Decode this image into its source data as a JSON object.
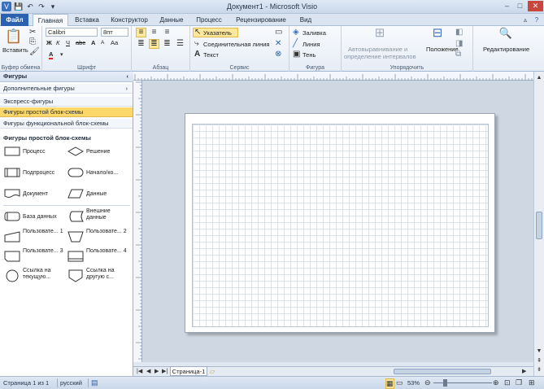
{
  "window": {
    "title": "Документ1 - Microsoft Visio",
    "min": "–",
    "max": "□",
    "close": "✕"
  },
  "quick_access": {
    "save": "💾",
    "undo": "↶",
    "redo": "↷",
    "customize": "▾"
  },
  "tabs": [
    {
      "label": "Файл"
    },
    {
      "label": "Главная"
    },
    {
      "label": "Вставка"
    },
    {
      "label": "Конструктор"
    },
    {
      "label": "Данные"
    },
    {
      "label": "Процесс"
    },
    {
      "label": "Рецензирование"
    },
    {
      "label": "Вид"
    }
  ],
  "ribbon": {
    "clipboard": {
      "paste": "Вставить",
      "label": "Буфер обмена"
    },
    "font": {
      "name": "Calibri",
      "size": "8пт",
      "grow": "A",
      "shrink": "A",
      "bold": "Ж",
      "italic": "К",
      "underline": "Ч",
      "strike": "abc",
      "case": "Aa",
      "color": "A",
      "label": "Шрифт"
    },
    "paragraph": {
      "label": "Абзац"
    },
    "tools": {
      "pointer": "Указатель",
      "connector": "Соединительная линия",
      "text": "Текст",
      "label": "Сервис"
    },
    "shape": {
      "fill": "Заливка",
      "line": "Линия",
      "shadow": "Тень",
      "label": "Фигура"
    },
    "arrange": {
      "auto": "Автовыравнивание и",
      "auto2": "определение интервалов",
      "position": "Положение",
      "label": "Упорядочить"
    },
    "editing": {
      "label": "Редактирование"
    },
    "accent_color": "#2a62b0"
  },
  "panel": {
    "title": "Фигуры",
    "collapse": "‹",
    "items": [
      {
        "label": "Дополнительные фигуры"
      },
      {
        "label": "Экспресс-фигуры"
      },
      {
        "label": "Фигуры простой блок-схемы"
      },
      {
        "label": "Фигуры функциональной блок-схемы"
      }
    ],
    "stencil_title": "Фигуры простой блок-схемы",
    "shapes": [
      {
        "label": "Процесс"
      },
      {
        "label": "Решение"
      },
      {
        "label": "Подпроцесс"
      },
      {
        "label": "Начало/ко..."
      },
      {
        "label": "Документ"
      },
      {
        "label": "Данные"
      },
      {
        "label": "База данных"
      },
      {
        "label": "Внешние данные"
      },
      {
        "label": "Пользовате... 1"
      },
      {
        "label": "Пользовате... 2"
      },
      {
        "label": "Пользовате... 3"
      },
      {
        "label": "Пользовате... 4"
      },
      {
        "label": "Ссылка на текущую..."
      },
      {
        "label": "Ссылка на другую с..."
      }
    ]
  },
  "page_tabs": {
    "current": "Страница-1"
  },
  "status": {
    "page": "Страница 1 из 1",
    "language": "русский",
    "zoom": "53%"
  }
}
